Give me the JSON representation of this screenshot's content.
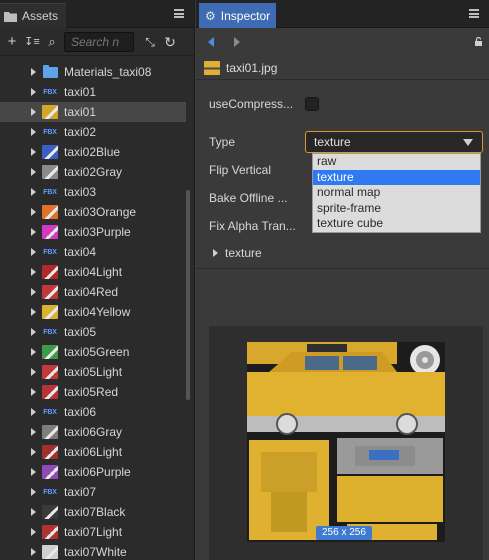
{
  "assets": {
    "tab_label": "Assets",
    "search_placeholder": "Search n",
    "items": [
      {
        "label": "Materials_taxi08",
        "kind": "folder"
      },
      {
        "label": "taxi01",
        "kind": "fbx"
      },
      {
        "label": "taxi01",
        "kind": "texture",
        "color": "#d4a62a",
        "selected": true
      },
      {
        "label": "taxi02",
        "kind": "fbx"
      },
      {
        "label": "taxi02Blue",
        "kind": "texture",
        "color": "#3b5fc4"
      },
      {
        "label": "taxi02Gray",
        "kind": "texture",
        "color": "#8a8a8a"
      },
      {
        "label": "taxi03",
        "kind": "fbx"
      },
      {
        "label": "taxi03Orange",
        "kind": "texture",
        "color": "#e0702a"
      },
      {
        "label": "taxi03Purple",
        "kind": "texture",
        "color": "#d23ac2"
      },
      {
        "label": "taxi04",
        "kind": "fbx"
      },
      {
        "label": "taxi04Light",
        "kind": "texture",
        "color": "#b02a2a"
      },
      {
        "label": "taxi04Red",
        "kind": "texture",
        "color": "#c0383a"
      },
      {
        "label": "taxi04Yellow",
        "kind": "texture",
        "color": "#d9b230"
      },
      {
        "label": "taxi05",
        "kind": "fbx"
      },
      {
        "label": "taxi05Green",
        "kind": "texture",
        "color": "#3e9a48"
      },
      {
        "label": "taxi05Light",
        "kind": "texture",
        "color": "#c23a3a"
      },
      {
        "label": "taxi05Red",
        "kind": "texture",
        "color": "#b8323a"
      },
      {
        "label": "taxi06",
        "kind": "fbx"
      },
      {
        "label": "taxi06Gray",
        "kind": "texture",
        "color": "#7d7d7d"
      },
      {
        "label": "taxi06Light",
        "kind": "texture",
        "color": "#a03030"
      },
      {
        "label": "taxi06Purple",
        "kind": "texture",
        "color": "#8f4ab6"
      },
      {
        "label": "taxi07",
        "kind": "fbx"
      },
      {
        "label": "taxi07Black",
        "kind": "texture",
        "color": "#3a3a3a"
      },
      {
        "label": "taxi07Light",
        "kind": "texture",
        "color": "#b03232"
      },
      {
        "label": "taxi07White",
        "kind": "texture",
        "color": "#cfcfcf"
      }
    ]
  },
  "inspector": {
    "tab_label": "Inspector",
    "file_name": "taxi01.jpg",
    "props": {
      "use_compress": "useCompress...",
      "type": "Type",
      "flip_vertical": "Flip Vertical",
      "bake_offline": "Bake Offline ...",
      "fix_alpha": "Fix Alpha Tran..."
    },
    "type_value": "texture",
    "type_options": [
      "raw",
      "texture",
      "normal map",
      "sprite-frame",
      "texture cube"
    ],
    "active_option_index": 1,
    "section_label": "texture",
    "preview_size": "256 x 256"
  },
  "colors": {
    "accent_tab": "#3e6bb3",
    "select_border": "#d99a2b",
    "option_highlight": "#2f7af0",
    "fbx_text": "#5aa0ff",
    "folder": "#5fa3e8"
  }
}
